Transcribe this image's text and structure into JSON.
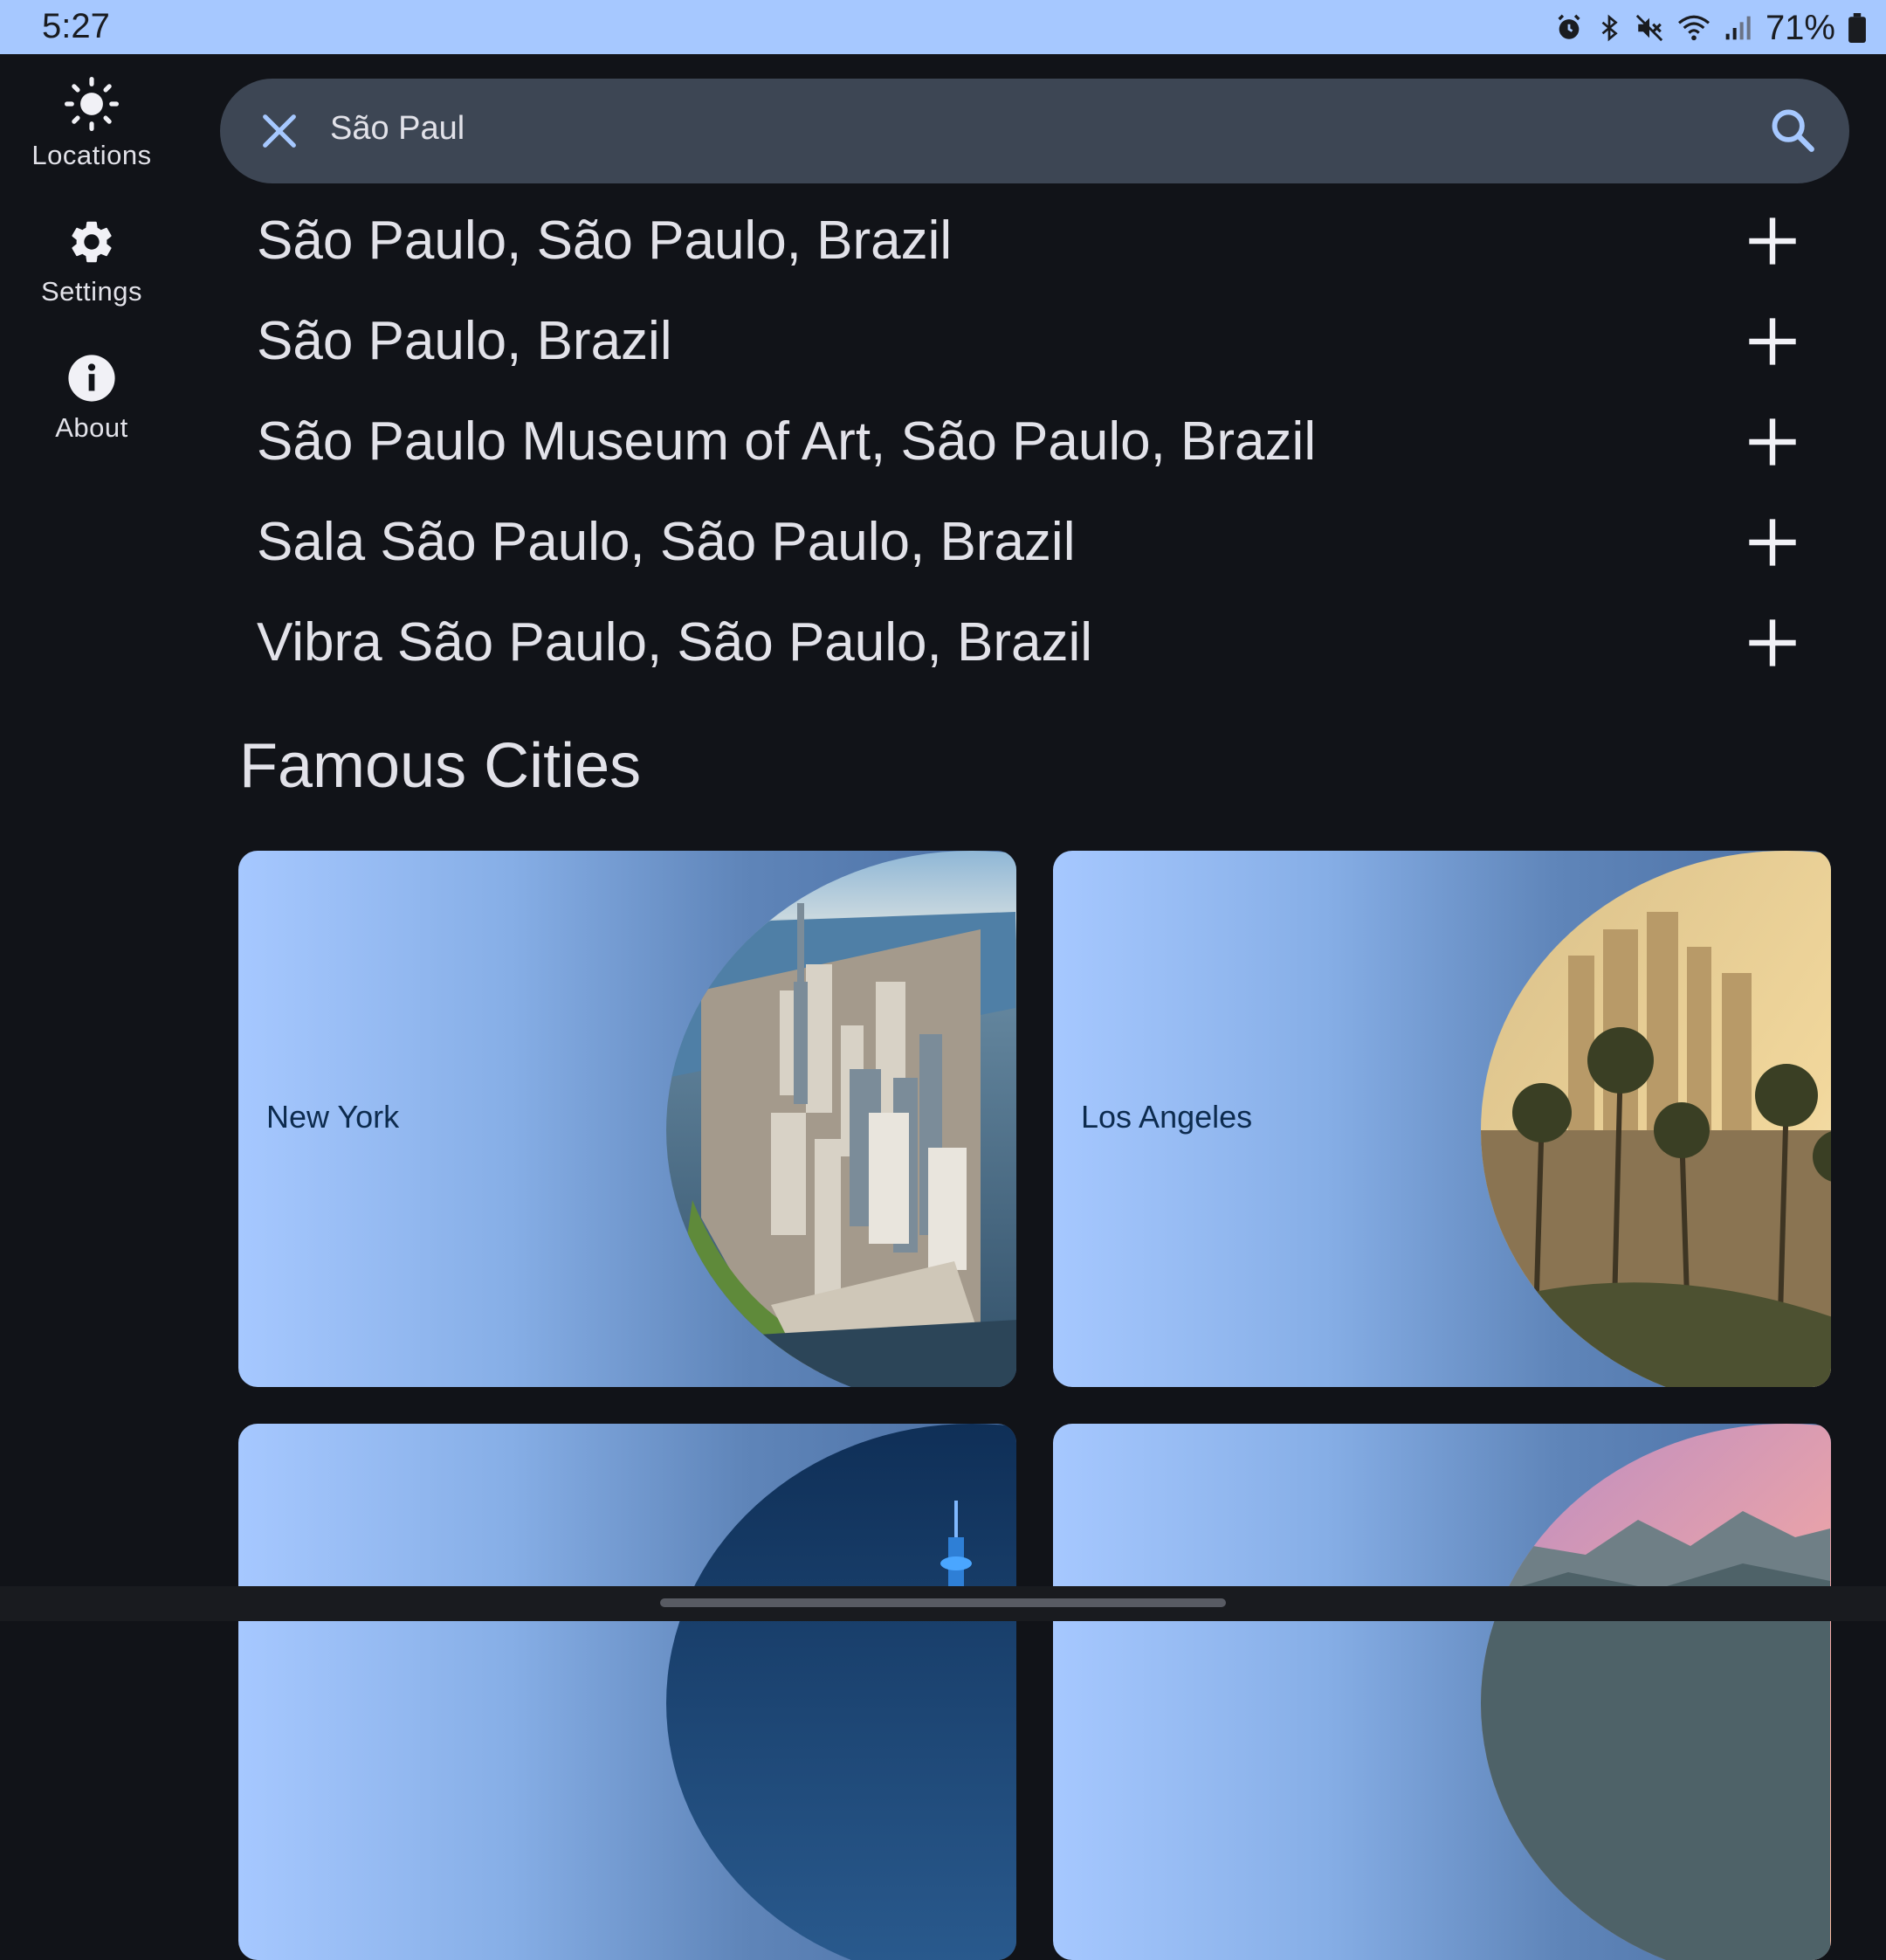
{
  "status_bar": {
    "time": "5:27",
    "battery": "71%"
  },
  "rail": {
    "items": [
      {
        "label": "Locations",
        "icon": "sun-icon"
      },
      {
        "label": "Settings",
        "icon": "gear-icon"
      },
      {
        "label": "About",
        "icon": "info-icon"
      }
    ]
  },
  "search": {
    "query": "São Paul"
  },
  "results": [
    "São Paulo, São Paulo, Brazil",
    "São Paulo, Brazil",
    "São Paulo Museum of Art, São Paulo, Brazil",
    "Sala São Paulo, São Paulo, Brazil",
    "Vibra São Paulo, São Paulo, Brazil"
  ],
  "famous": {
    "title": "Famous Cities",
    "cities": [
      "New York",
      "Los Angeles"
    ]
  },
  "colors": {
    "status_bar": "#a6c8ff",
    "background": "#111318",
    "search_bar": "#3d4654",
    "accent": "#a6c8ff",
    "card_text": "#0d2b4e"
  }
}
